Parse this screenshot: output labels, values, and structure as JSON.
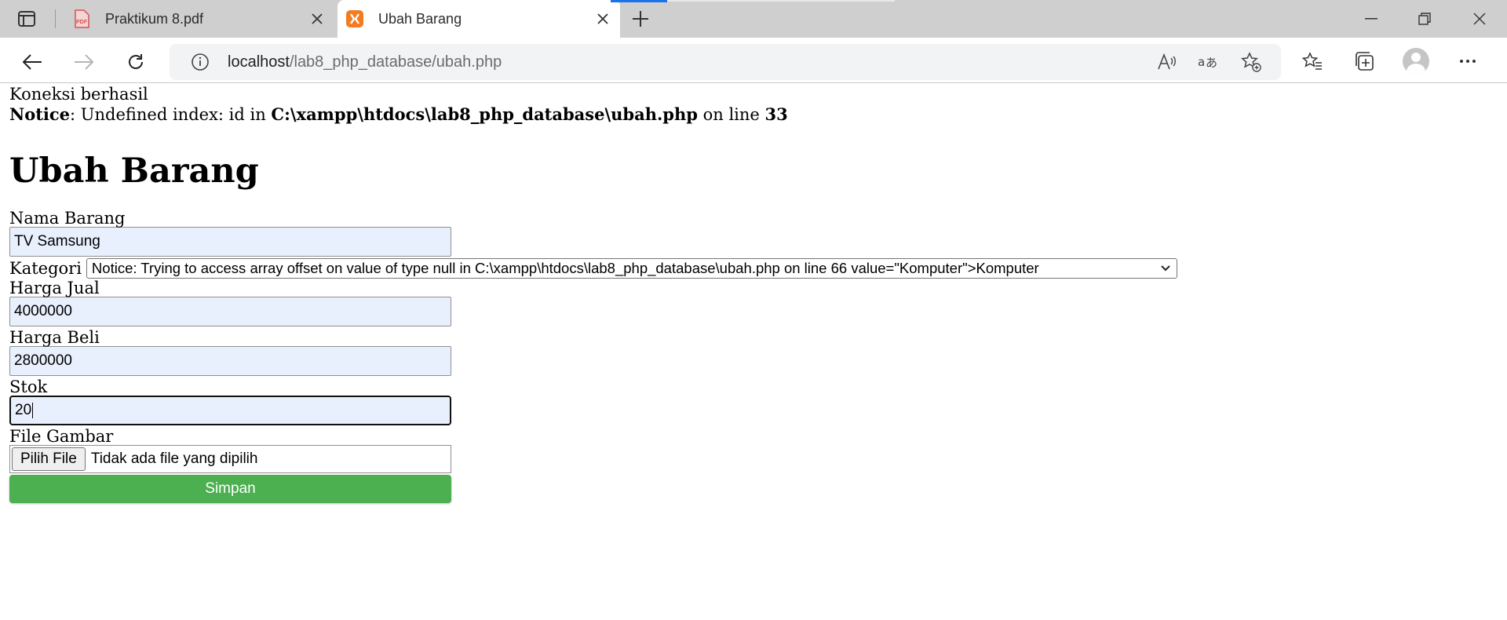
{
  "browser": {
    "tabs": [
      {
        "title": "Praktikum 8.pdf",
        "icon": "pdf-icon",
        "active": false
      },
      {
        "title": "Ubah Barang",
        "icon": "xampp-icon",
        "active": true
      }
    ],
    "url_host": "localhost",
    "url_path": "/lab8_php_database/ubah.php"
  },
  "page": {
    "connection_status": "Koneksi berhasil",
    "notice": {
      "label": "Notice",
      "text1": ": Undefined index: id in ",
      "path": "C:\\xampp\\htdocs\\lab8_php_database\\ubah.php",
      "text2": " on line ",
      "line": "33"
    },
    "heading": "Ubah Barang",
    "form": {
      "nama_label": "Nama Barang",
      "nama_value": "TV Samsung",
      "kategori_label": "Kategori",
      "kategori_value": "Notice: Trying to access array offset on value of type null in C:\\xampp\\htdocs\\lab8_php_database\\ubah.php on line 66 value=\"Komputer\">Komputer",
      "harga_jual_label": "Harga Jual",
      "harga_jual_value": "4000000",
      "harga_beli_label": "Harga Beli",
      "harga_beli_value": "2800000",
      "stok_label": "Stok",
      "stok_value": "20",
      "file_label": "File Gambar",
      "file_button": "Pilih File",
      "file_status": "Tidak ada file yang dipilih",
      "submit_label": "Simpan"
    }
  },
  "colors": {
    "submit_bg": "#4caf50",
    "input_autofill_bg": "#e8f0fe",
    "loading_bar": "#1a73e8"
  }
}
